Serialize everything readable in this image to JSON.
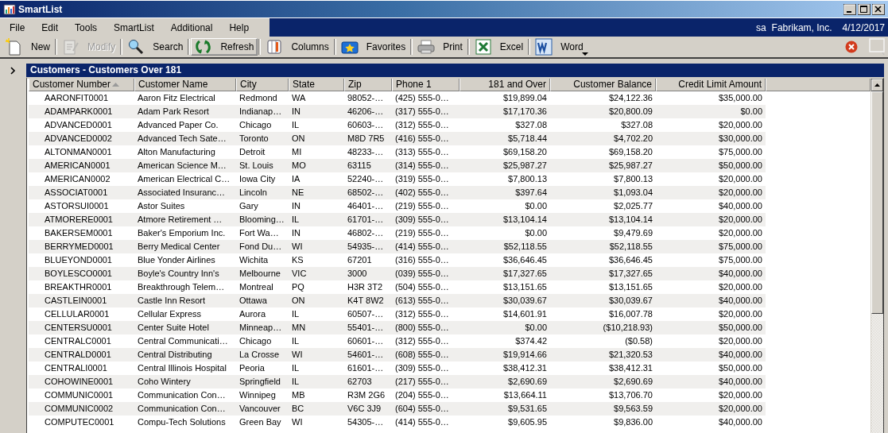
{
  "window": {
    "title": "SmartList"
  },
  "menu": [
    "File",
    "Edit",
    "Tools",
    "SmartList",
    "Additional",
    "Help"
  ],
  "session": {
    "user": "sa",
    "company": "Fabrikam, Inc.",
    "date": "4/12/2017"
  },
  "toolbar": [
    {
      "kind": "new",
      "label": "New",
      "disabled": false,
      "pressed": false,
      "dropdown": false
    },
    {
      "kind": "modify",
      "label": "Modify",
      "disabled": true,
      "pressed": false,
      "dropdown": false
    },
    {
      "kind": "search",
      "label": "Search",
      "disabled": false,
      "pressed": false,
      "dropdown": false
    },
    {
      "kind": "refresh",
      "label": "Refresh",
      "disabled": false,
      "pressed": true,
      "dropdown": false
    },
    {
      "kind": "columns",
      "label": "Columns",
      "disabled": false,
      "pressed": false,
      "dropdown": false
    },
    {
      "kind": "favorites",
      "label": "Favorites",
      "disabled": false,
      "pressed": false,
      "dropdown": false
    },
    {
      "kind": "print",
      "label": "Print",
      "disabled": false,
      "pressed": false,
      "dropdown": false
    },
    {
      "kind": "excel",
      "label": "Excel",
      "disabled": false,
      "pressed": false,
      "dropdown": false
    },
    {
      "kind": "word",
      "label": "Word",
      "disabled": false,
      "pressed": false,
      "dropdown": true
    }
  ],
  "list": {
    "title": "Customers - Customers Over 181",
    "columns": [
      {
        "label": "Customer Number",
        "kind": "text",
        "sorted": true
      },
      {
        "label": "Customer Name",
        "kind": "text",
        "sorted": false
      },
      {
        "label": "City",
        "kind": "text",
        "sorted": false
      },
      {
        "label": "State",
        "kind": "text",
        "sorted": false
      },
      {
        "label": "Zip",
        "kind": "text",
        "sorted": false
      },
      {
        "label": "Phone 1",
        "kind": "text",
        "sorted": false
      },
      {
        "label": "181 and Over",
        "kind": "money",
        "sorted": false
      },
      {
        "label": "Customer Balance",
        "kind": "money",
        "sorted": false
      },
      {
        "label": "Credit Limit Amount",
        "kind": "money",
        "sorted": false
      }
    ],
    "rows": [
      [
        "AARONFIT0001",
        "Aaron Fitz Electrical",
        "Redmond",
        "WA",
        "98052-…",
        "(425) 555-0…",
        "$19,899.04",
        "$24,122.36",
        "$35,000.00"
      ],
      [
        "ADAMPARK0001",
        "Adam Park Resort",
        "Indianap…",
        "IN",
        "46206-…",
        "(317) 555-0…",
        "$17,170.36",
        "$20,800.09",
        "$0.00"
      ],
      [
        "ADVANCED0001",
        "Advanced Paper Co.",
        "Chicago",
        "IL",
        "60603-…",
        "(312) 555-0…",
        "$327.08",
        "$327.08",
        "$20,000.00"
      ],
      [
        "ADVANCED0002",
        "Advanced Tech Sate…",
        "Toronto",
        "ON",
        "M8D 7R5",
        "(416) 555-0…",
        "$5,718.44",
        "$4,702.20",
        "$30,000.00"
      ],
      [
        "ALTONMAN0001",
        "Alton Manufacturing",
        "Detroit",
        "MI",
        "48233-…",
        "(313) 555-0…",
        "$69,158.20",
        "$69,158.20",
        "$75,000.00"
      ],
      [
        "AMERICAN0001",
        "American Science M…",
        "St. Louis",
        "MO",
        "63115",
        "(314) 555-0…",
        "$25,987.27",
        "$25,987.27",
        "$50,000.00"
      ],
      [
        "AMERICAN0002",
        "American Electrical C…",
        "Iowa City",
        "IA",
        "52240-…",
        "(319) 555-0…",
        "$7,800.13",
        "$7,800.13",
        "$20,000.00"
      ],
      [
        "ASSOCIAT0001",
        "Associated Insuranc…",
        "Lincoln",
        "NE",
        "68502-…",
        "(402) 555-0…",
        "$397.64",
        "$1,093.04",
        "$20,000.00"
      ],
      [
        "ASTORSUI0001",
        "Astor Suites",
        "Gary",
        "IN",
        "46401-…",
        "(219) 555-0…",
        "$0.00",
        "$2,025.77",
        "$40,000.00"
      ],
      [
        "ATMORERE0001",
        "Atmore Retirement …",
        "Blooming…",
        "IL",
        "61701-…",
        "(309) 555-0…",
        "$13,104.14",
        "$13,104.14",
        "$20,000.00"
      ],
      [
        "BAKERSEM0001",
        "Baker's Emporium Inc.",
        "Fort Wa…",
        "IN",
        "46802-…",
        "(219) 555-0…",
        "$0.00",
        "$9,479.69",
        "$20,000.00"
      ],
      [
        "BERRYMED0001",
        "Berry Medical Center",
        "Fond Du…",
        "WI",
        "54935-…",
        "(414) 555-0…",
        "$52,118.55",
        "$52,118.55",
        "$75,000.00"
      ],
      [
        "BLUEYOND0001",
        "Blue Yonder Airlines",
        "Wichita",
        "KS",
        "67201",
        "(316) 555-0…",
        "$36,646.45",
        "$36,646.45",
        "$75,000.00"
      ],
      [
        "BOYLESCO0001",
        "Boyle's Country Inn's",
        "Melbourne",
        "VIC",
        "3000",
        "(039) 555-0…",
        "$17,327.65",
        "$17,327.65",
        "$40,000.00"
      ],
      [
        "BREAKTHR0001",
        "Breakthrough Telem…",
        "Montreal",
        "PQ",
        "H3R 3T2",
        "(504) 555-0…",
        "$13,151.65",
        "$13,151.65",
        "$20,000.00"
      ],
      [
        "CASTLEIN0001",
        "Castle Inn Resort",
        "Ottawa",
        "ON",
        "K4T 8W2",
        "(613) 555-0…",
        "$30,039.67",
        "$30,039.67",
        "$40,000.00"
      ],
      [
        "CELLULAR0001",
        "Cellular Express",
        "Aurora",
        "IL",
        "60507-…",
        "(312) 555-0…",
        "$14,601.91",
        "$16,007.78",
        "$20,000.00"
      ],
      [
        "CENTERSU0001",
        "Center Suite Hotel",
        "Minneap…",
        "MN",
        "55401-…",
        "(800) 555-0…",
        "$0.00",
        "($10,218.93)",
        "$50,000.00"
      ],
      [
        "CENTRALC0001",
        "Central Communicati…",
        "Chicago",
        "IL",
        "60601-…",
        "(312) 555-0…",
        "$374.42",
        "($0.58)",
        "$20,000.00"
      ],
      [
        "CENTRALD0001",
        "Central Distributing",
        "La Crosse",
        "WI",
        "54601-…",
        "(608) 555-0…",
        "$19,914.66",
        "$21,320.53",
        "$40,000.00"
      ],
      [
        "CENTRALI0001",
        "Central Illinois Hospital",
        "Peoria",
        "IL",
        "61601-…",
        "(309) 555-0…",
        "$38,412.31",
        "$38,412.31",
        "$50,000.00"
      ],
      [
        "COHOWINE0001",
        "Coho Wintery",
        "Springfield",
        "IL",
        "62703",
        "(217) 555-0…",
        "$2,690.69",
        "$2,690.69",
        "$40,000.00"
      ],
      [
        "COMMUNIC0001",
        "Communication Con…",
        "Winnipeg",
        "MB",
        "R3M 2G6",
        "(204) 555-0…",
        "$13,664.11",
        "$13,706.70",
        "$20,000.00"
      ],
      [
        "COMMUNIC0002",
        "Communication Con…",
        "Vancouver",
        "BC",
        "V6C 3J9",
        "(604) 555-0…",
        "$9,531.65",
        "$9,563.59",
        "$20,000.00"
      ],
      [
        "COMPUTEC0001",
        "Compu-Tech Solutions",
        "Green Bay",
        "WI",
        "54305-…",
        "(414) 555-0…",
        "$9,605.95",
        "$9,836.00",
        "$40,000.00"
      ]
    ]
  }
}
